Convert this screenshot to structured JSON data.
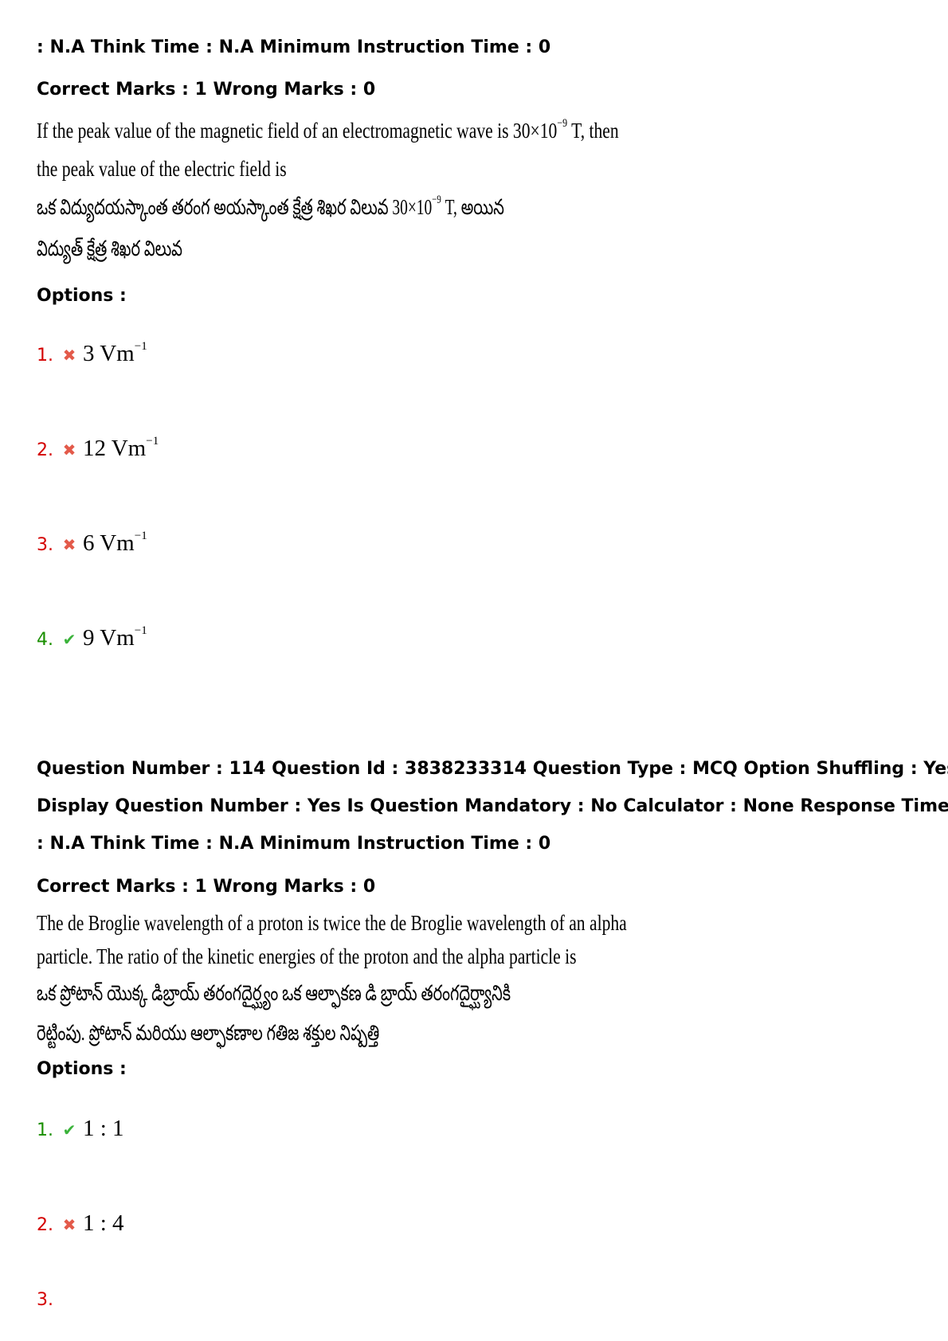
{
  "block1": {
    "meta_line3": ": N.A Think Time : N.A Minimum Instruction Time : 0",
    "marks": "Correct Marks : 1 Wrong Marks : 0",
    "q_en_1_pre": "If the peak value of the magnetic field of an electromagnetic wave is  30×10",
    "q_en_1_exp": "−9",
    "q_en_1_post": " T, then",
    "q_en_2": "the peak value of the electric field is",
    "q_te_1_pre": "ఒక విద్యుదయస్కాంత తరంగ అయస్కాంత క్షేత్ర శిఖర విలువ 30×10",
    "q_te_1_exp": "−9",
    "q_te_1_post": " T, అయిన",
    "q_te_2": "విద్యుత్ క్షేత్ర శిఖర విలువ",
    "options_label": "Options :",
    "options": [
      {
        "num": "1.",
        "mark": "✖",
        "value": "3 Vm",
        "exp": "−1"
      },
      {
        "num": "2.",
        "mark": "✖",
        "value": "12 Vm",
        "exp": "−1"
      },
      {
        "num": "3.",
        "mark": "✖",
        "value": "6 Vm",
        "exp": "−1"
      },
      {
        "num": "4.",
        "mark": "✔",
        "value": "9 Vm",
        "exp": "−1"
      }
    ]
  },
  "block2": {
    "meta_line1": "Question Number : 114 Question Id : 3838233314 Question Type : MCQ Option Shuffling : Yes",
    "meta_line2": "Display Question Number : Yes Is Question Mandatory : No Calculator : None Response Time",
    "meta_line3": ": N.A Think Time : N.A Minimum Instruction Time : 0",
    "marks": "Correct Marks : 1 Wrong Marks : 0",
    "q_en_1": "The de Broglie wavelength of a proton is twice the de Broglie wavelength of an alpha",
    "q_en_2": "particle. The ratio of the kinetic energies of the proton and the alpha particle is",
    "q_te_1": "ఒక ప్రోటాన్ యొక్క డిబ్రాయ్ తరంగదైర్ఘ్యం ఒక ఆల్ఫాకణ డి బ్రాయ్ తరంగదైర్ఘ్యానికి",
    "q_te_2": "రెట్టింపు. ప్రోటాన్ మరియు ఆల్ఫాకణాల గతిజ శక్తుల నిష్పత్తి",
    "options_label": "Options :",
    "options": [
      {
        "num": "1.",
        "mark": "✔",
        "value": "1 : 1"
      },
      {
        "num": "2.",
        "mark": "✖",
        "value": "1 : 4"
      },
      {
        "num": "3.",
        "mark": "",
        "value": ""
      }
    ]
  }
}
